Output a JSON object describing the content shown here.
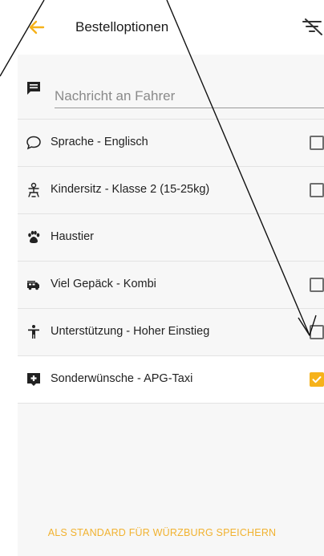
{
  "header": {
    "title": "Bestelloptionen",
    "back_icon": "arrow-left-icon",
    "filter_icon": "filter-off-icon"
  },
  "message": {
    "placeholder": "Nachricht an Fahrer",
    "icon": "message-icon"
  },
  "options": [
    {
      "icon": "speech-bubble-icon",
      "label": "Sprache - Englisch",
      "checkbox": true,
      "checked": false
    },
    {
      "icon": "child-seat-icon",
      "label": "Kindersitz - Klasse 2 (15-25kg)",
      "checkbox": true,
      "checked": false
    },
    {
      "icon": "paw-icon",
      "label": "Haustier",
      "checkbox": false,
      "checked": false
    },
    {
      "icon": "station-wagon-icon",
      "label": "Viel Gepäck - Kombi",
      "checkbox": true,
      "checked": false
    },
    {
      "icon": "person-icon",
      "label": "Unterstützung - Hoher Einstieg",
      "checkbox": true,
      "checked": false
    },
    {
      "icon": "special-request-icon",
      "label": "Sonderwünsche - APG-Taxi",
      "checkbox": true,
      "checked": true
    }
  ],
  "footer": {
    "save_label": "ALS STANDARD FÜR WÜRZBURG SPEICHERN"
  },
  "colors": {
    "accent": "#f6b21a",
    "footer_text": "#f1b230"
  }
}
